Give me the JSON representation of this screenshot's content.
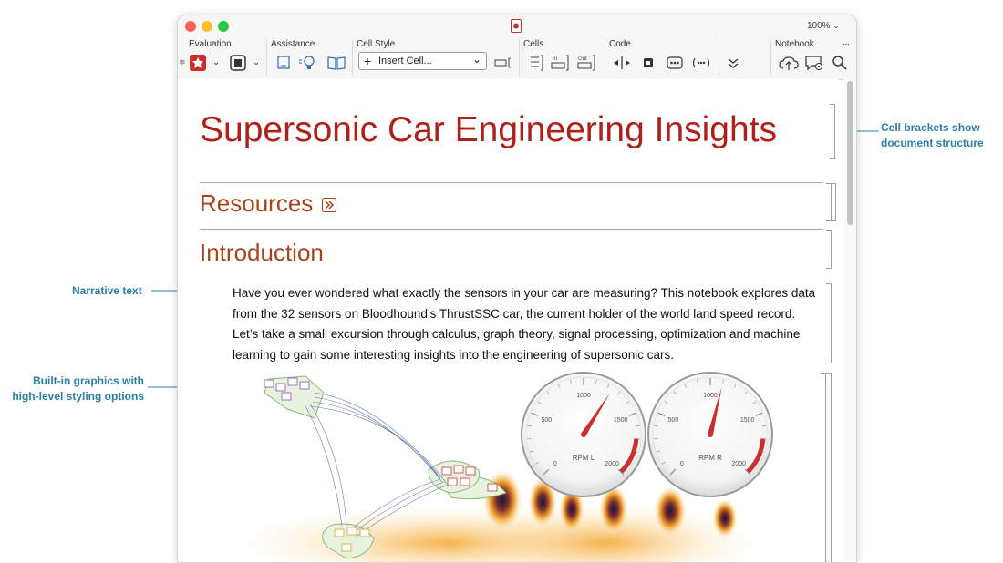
{
  "window": {
    "zoom": "100%",
    "toolbar": {
      "groups": [
        "Evaluation",
        "Assistance",
        "Cell Style",
        "Cells",
        "Code",
        "Notebook"
      ],
      "cell_style_select": "Insert Cell...",
      "more": "···"
    }
  },
  "notebook": {
    "title": "Supersonic Car Engineering Insights",
    "section_resources": "Resources",
    "section_introduction": "Introduction",
    "paragraph_lines": [
      "Have you ever wondered what exactly the sensors in your car are measuring? This notebook explores data",
      "from the 32 sensors on Bloodhound’s ThrustSSC car, the current holder of the world land speed record.",
      "Let’s take a small excursion through calculus, graph theory, signal processing, optimization and machine",
      "learning to gain some interesting insights into the engineering of supersonic cars."
    ],
    "gauges": [
      {
        "label": "RPM L",
        "ticks": [
          "0",
          "500",
          "1000",
          "1500",
          "2000"
        ],
        "value_fraction": 0.62
      },
      {
        "label": "RPM R",
        "ticks": [
          "0",
          "500",
          "1000",
          "1500",
          "2000"
        ],
        "value_fraction": 0.55
      }
    ]
  },
  "annotations": {
    "brackets": [
      "Cell brackets show",
      "document structure"
    ],
    "narrative": "Narrative text",
    "graphics": [
      "Built-in graphics with",
      "high-level styling options"
    ]
  },
  "colors": {
    "title": "#b0201b",
    "section": "#a8441a",
    "annotation": "#2a7fae",
    "close": "#ff5f57",
    "minimize": "#febc2e",
    "maximize": "#28c840"
  }
}
